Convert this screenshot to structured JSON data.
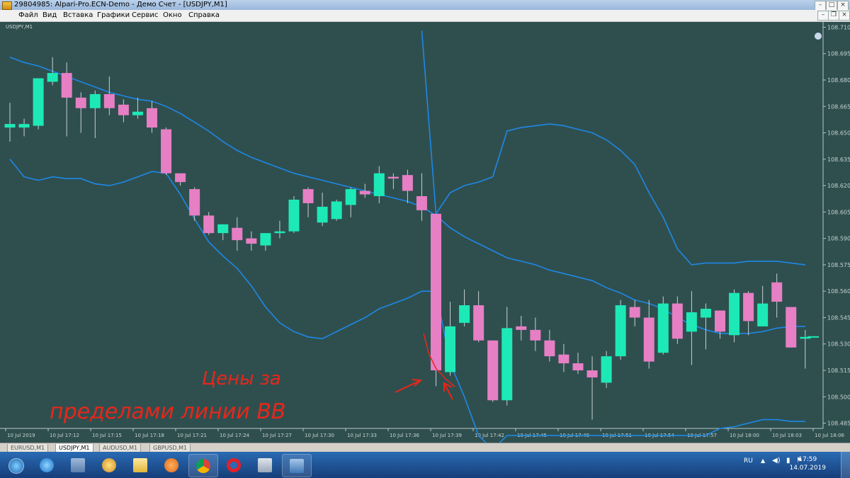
{
  "window": {
    "title": "29804985: Alpari-Pro.ECN-Demo - Демо Счет - [USDJPY,M1]"
  },
  "menu": {
    "items": [
      "Файл",
      "Вид",
      "Вставка",
      "Графики",
      "Сервис",
      "Окно",
      "Справка"
    ]
  },
  "chart_window": {
    "symbol_label": "USDJPY,M1",
    "annotation_line1": "Цены за",
    "annotation_line2": "пределами линии ВВ"
  },
  "colors": {
    "background": "#2f4f4f",
    "bull": "#1de9b6",
    "bear": "#e67fc4",
    "bands": "#1e88e5",
    "axis_text": "#c8d0d0",
    "annotation": "#e8261a"
  },
  "chart_data": {
    "type": "candlestick",
    "timeframe": "M1",
    "symbol": "USDJPY",
    "y_ticks": [
      "108.710",
      "108.695",
      "108.680",
      "108.665",
      "108.650",
      "108.635",
      "108.620",
      "108.605",
      "108.590",
      "108.575",
      "108.560",
      "108.545",
      "108.530",
      "108.515",
      "108.500",
      "108.485"
    ],
    "ylim": [
      108.482,
      108.713
    ],
    "x_ticks": [
      "10 Jul 2019",
      "10 Jul 17:12",
      "10 Jul 17:15",
      "10 Jul 17:18",
      "10 Jul 17:21",
      "10 Jul 17:24",
      "10 Jul 17:27",
      "10 Jul 17:30",
      "10 Jul 17:33",
      "10 Jul 17:36",
      "10 Jul 17:39",
      "10 Jul 17:42",
      "10 Jul 17:45",
      "10 Jul 17:48",
      "10 Jul 17:51",
      "10 Jul 17:54",
      "10 Jul 17:57",
      "10 Jul 18:00",
      "10 Jul 18:03",
      "10 Jul 18:06"
    ],
    "candles": [
      {
        "o": 108.653,
        "h": 108.667,
        "l": 108.645,
        "c": 108.655
      },
      {
        "o": 108.653,
        "h": 108.658,
        "l": 108.648,
        "c": 108.655
      },
      {
        "o": 108.654,
        "h": 108.68,
        "l": 108.652,
        "c": 108.681
      },
      {
        "o": 108.679,
        "h": 108.693,
        "l": 108.677,
        "c": 108.684
      },
      {
        "o": 108.684,
        "h": 108.69,
        "l": 108.648,
        "c": 108.67
      },
      {
        "o": 108.67,
        "h": 108.673,
        "l": 108.65,
        "c": 108.664
      },
      {
        "o": 108.664,
        "h": 108.674,
        "l": 108.647,
        "c": 108.672
      },
      {
        "o": 108.672,
        "h": 108.682,
        "l": 108.66,
        "c": 108.664
      },
      {
        "o": 108.666,
        "h": 108.669,
        "l": 108.656,
        "c": 108.66
      },
      {
        "o": 108.66,
        "h": 108.67,
        "l": 108.658,
        "c": 108.662
      },
      {
        "o": 108.664,
        "h": 108.668,
        "l": 108.65,
        "c": 108.653
      },
      {
        "o": 108.652,
        "h": 108.653,
        "l": 108.626,
        "c": 108.627
      },
      {
        "o": 108.627,
        "h": 108.624,
        "l": 108.62,
        "c": 108.622
      },
      {
        "o": 108.618,
        "h": 108.619,
        "l": 108.6,
        "c": 108.603
      },
      {
        "o": 108.603,
        "h": 108.605,
        "l": 108.592,
        "c": 108.593
      },
      {
        "o": 108.593,
        "h": 108.598,
        "l": 108.589,
        "c": 108.598
      },
      {
        "o": 108.596,
        "h": 108.602,
        "l": 108.583,
        "c": 108.589
      },
      {
        "o": 108.59,
        "h": 108.594,
        "l": 108.583,
        "c": 108.587
      },
      {
        "o": 108.586,
        "h": 108.592,
        "l": 108.583,
        "c": 108.593
      },
      {
        "o": 108.593,
        "h": 108.6,
        "l": 108.59,
        "c": 108.594
      },
      {
        "o": 108.594,
        "h": 108.614,
        "l": 108.593,
        "c": 108.612
      },
      {
        "o": 108.618,
        "h": 108.619,
        "l": 108.602,
        "c": 108.61
      },
      {
        "o": 108.599,
        "h": 108.616,
        "l": 108.597,
        "c": 108.608
      },
      {
        "o": 108.601,
        "h": 108.612,
        "l": 108.6,
        "c": 108.611
      },
      {
        "o": 108.609,
        "h": 108.619,
        "l": 108.602,
        "c": 108.618
      },
      {
        "o": 108.617,
        "h": 108.621,
        "l": 108.613,
        "c": 108.615
      },
      {
        "o": 108.614,
        "h": 108.631,
        "l": 108.61,
        "c": 108.627
      },
      {
        "o": 108.625,
        "h": 108.627,
        "l": 108.618,
        "c": 108.624
      },
      {
        "o": 108.626,
        "h": 108.629,
        "l": 108.61,
        "c": 108.617
      },
      {
        "o": 108.614,
        "h": 108.627,
        "l": 108.6,
        "c": 108.606
      },
      {
        "o": 108.604,
        "h": 108.604,
        "l": 108.506,
        "c": 108.515
      },
      {
        "o": 108.514,
        "h": 108.554,
        "l": 108.512,
        "c": 108.54
      },
      {
        "o": 108.542,
        "h": 108.561,
        "l": 108.54,
        "c": 108.552
      },
      {
        "o": 108.552,
        "h": 108.56,
        "l": 108.531,
        "c": 108.532
      },
      {
        "o": 108.532,
        "h": 108.532,
        "l": 108.497,
        "c": 108.498
      },
      {
        "o": 108.498,
        "h": 108.551,
        "l": 108.495,
        "c": 108.539
      },
      {
        "o": 108.54,
        "h": 108.546,
        "l": 108.532,
        "c": 108.538
      },
      {
        "o": 108.538,
        "h": 108.545,
        "l": 108.526,
        "c": 108.532
      },
      {
        "o": 108.532,
        "h": 108.538,
        "l": 108.52,
        "c": 108.523
      },
      {
        "o": 108.524,
        "h": 108.53,
        "l": 108.514,
        "c": 108.519
      },
      {
        "o": 108.519,
        "h": 108.525,
        "l": 108.513,
        "c": 108.515
      },
      {
        "o": 108.515,
        "h": 108.523,
        "l": 108.487,
        "c": 108.511
      },
      {
        "o": 108.508,
        "h": 108.526,
        "l": 108.505,
        "c": 108.523
      },
      {
        "o": 108.523,
        "h": 108.555,
        "l": 108.521,
        "c": 108.552
      },
      {
        "o": 108.551,
        "h": 108.555,
        "l": 108.54,
        "c": 108.545
      },
      {
        "o": 108.545,
        "h": 108.555,
        "l": 108.516,
        "c": 108.52
      },
      {
        "o": 108.525,
        "h": 108.557,
        "l": 108.524,
        "c": 108.553
      },
      {
        "o": 108.553,
        "h": 108.557,
        "l": 108.53,
        "c": 108.533
      },
      {
        "o": 108.537,
        "h": 108.56,
        "l": 108.518,
        "c": 108.548
      },
      {
        "o": 108.545,
        "h": 108.553,
        "l": 108.527,
        "c": 108.55
      },
      {
        "o": 108.549,
        "h": 108.549,
        "l": 108.533,
        "c": 108.537
      },
      {
        "o": 108.535,
        "h": 108.561,
        "l": 108.531,
        "c": 108.559
      },
      {
        "o": 108.559,
        "h": 108.56,
        "l": 108.535,
        "c": 108.543
      },
      {
        "o": 108.54,
        "h": 108.563,
        "l": 108.54,
        "c": 108.553
      },
      {
        "o": 108.565,
        "h": 108.57,
        "l": 108.545,
        "c": 108.554
      },
      {
        "o": 108.551,
        "h": 108.551,
        "l": 108.528,
        "c": 108.528
      },
      {
        "o": 108.533,
        "h": 108.538,
        "l": 108.516,
        "c": 108.534
      }
    ],
    "bands": {
      "upper": [
        [
          108.708,
          29
        ],
        [
          108.604,
          30
        ],
        [
          108.616,
          31
        ],
        [
          108.62,
          32
        ],
        [
          108.622,
          33
        ],
        [
          108.625,
          34
        ],
        [
          108.651,
          35
        ],
        [
          108.653,
          36
        ],
        [
          108.654,
          37
        ],
        [
          108.655,
          38
        ],
        [
          108.654,
          39
        ],
        [
          108.652,
          40
        ],
        [
          108.65,
          41
        ],
        [
          108.646,
          42
        ],
        [
          108.64,
          43
        ],
        [
          108.632,
          44
        ],
        [
          108.616,
          45
        ],
        [
          108.602,
          46
        ],
        [
          108.584,
          47
        ],
        [
          108.575,
          48
        ],
        [
          108.576,
          49
        ],
        [
          108.576,
          50
        ],
        [
          108.576,
          51
        ],
        [
          108.577,
          52
        ],
        [
          108.577,
          53
        ],
        [
          108.577,
          54
        ],
        [
          108.576,
          55
        ],
        [
          108.575,
          56
        ]
      ],
      "middle": [
        [
          108.693,
          0
        ],
        [
          108.69,
          1
        ],
        [
          108.688,
          2
        ],
        [
          108.685,
          3
        ],
        [
          108.682,
          4
        ],
        [
          108.679,
          5
        ],
        [
          108.676,
          6
        ],
        [
          108.673,
          7
        ],
        [
          108.671,
          8
        ],
        [
          108.669,
          9
        ],
        [
          108.668,
          10
        ],
        [
          108.665,
          11
        ],
        [
          108.661,
          12
        ],
        [
          108.656,
          13
        ],
        [
          108.651,
          14
        ],
        [
          108.645,
          15
        ],
        [
          108.64,
          16
        ],
        [
          108.636,
          17
        ],
        [
          108.633,
          18
        ],
        [
          108.63,
          19
        ],
        [
          108.627,
          20
        ],
        [
          108.625,
          21
        ],
        [
          108.623,
          22
        ],
        [
          108.621,
          23
        ],
        [
          108.619,
          24
        ],
        [
          108.617,
          25
        ],
        [
          108.615,
          26
        ],
        [
          108.613,
          27
        ],
        [
          108.611,
          28
        ],
        [
          108.608,
          29
        ],
        [
          108.603,
          30
        ],
        [
          108.596,
          31
        ],
        [
          108.591,
          32
        ],
        [
          108.587,
          33
        ],
        [
          108.583,
          34
        ],
        [
          108.579,
          35
        ],
        [
          108.577,
          36
        ],
        [
          108.575,
          37
        ],
        [
          108.572,
          38
        ],
        [
          108.57,
          39
        ],
        [
          108.568,
          40
        ],
        [
          108.566,
          41
        ],
        [
          108.562,
          42
        ],
        [
          108.559,
          43
        ],
        [
          108.555,
          44
        ],
        [
          108.553,
          45
        ],
        [
          108.55,
          46
        ],
        [
          108.545,
          47
        ],
        [
          108.541,
          48
        ],
        [
          108.538,
          49
        ],
        [
          108.536,
          50
        ],
        [
          108.536,
          51
        ],
        [
          108.536,
          52
        ],
        [
          108.537,
          53
        ],
        [
          108.539,
          54
        ],
        [
          108.54,
          55
        ],
        [
          108.54,
          56
        ]
      ],
      "lower": [
        [
          108.635,
          0
        ],
        [
          108.625,
          1
        ],
        [
          108.623,
          2
        ],
        [
          108.625,
          3
        ],
        [
          108.624,
          4
        ],
        [
          108.624,
          5
        ],
        [
          108.621,
          6
        ],
        [
          108.62,
          7
        ],
        [
          108.622,
          8
        ],
        [
          108.625,
          9
        ],
        [
          108.628,
          10
        ],
        [
          108.627,
          11
        ],
        [
          108.615,
          12
        ],
        [
          108.601,
          13
        ],
        [
          108.588,
          14
        ],
        [
          108.58,
          15
        ],
        [
          108.573,
          16
        ],
        [
          108.563,
          17
        ],
        [
          108.551,
          18
        ],
        [
          108.542,
          19
        ],
        [
          108.537,
          20
        ],
        [
          108.534,
          21
        ],
        [
          108.533,
          22
        ],
        [
          108.537,
          23
        ],
        [
          108.541,
          24
        ],
        [
          108.545,
          25
        ],
        [
          108.55,
          26
        ],
        [
          108.553,
          27
        ],
        [
          108.556,
          28
        ],
        [
          108.56,
          29
        ],
        [
          108.56,
          30
        ],
        [
          108.519,
          31
        ],
        [
          108.5,
          32
        ],
        [
          108.478,
          33
        ],
        [
          108.47,
          34
        ],
        [
          108.478,
          35
        ],
        [
          108.478,
          36
        ],
        [
          108.478,
          37
        ],
        [
          108.478,
          38
        ],
        [
          108.478,
          39
        ],
        [
          108.478,
          40
        ],
        [
          108.478,
          41
        ],
        [
          108.478,
          42
        ],
        [
          108.478,
          43
        ],
        [
          108.478,
          44
        ],
        [
          108.478,
          45
        ],
        [
          108.478,
          46
        ],
        [
          108.478,
          47
        ],
        [
          108.478,
          48
        ],
        [
          108.478,
          49
        ],
        [
          108.482,
          50
        ],
        [
          108.483,
          51
        ],
        [
          108.485,
          52
        ],
        [
          108.487,
          53
        ],
        [
          108.487,
          54
        ],
        [
          108.486,
          55
        ],
        [
          108.486,
          56
        ]
      ]
    }
  },
  "tabs": [
    "EURUSD,M1",
    "USDJPY,M1",
    "AUDUSD,M1",
    "GBPUSD,M1"
  ],
  "active_tab": "USDJPY,M1",
  "taskbar": {
    "pinned_icons": [
      "windows-start-icon",
      "internet-explorer-icon",
      "notes-icon",
      "paint-icon",
      "file-explorer-icon",
      "media-player-icon",
      "chrome-icon",
      "opera-icon",
      "calculator-icon",
      "metatrader-icon"
    ],
    "language": "RU",
    "time": "17:59",
    "date": "14.07.2019"
  }
}
